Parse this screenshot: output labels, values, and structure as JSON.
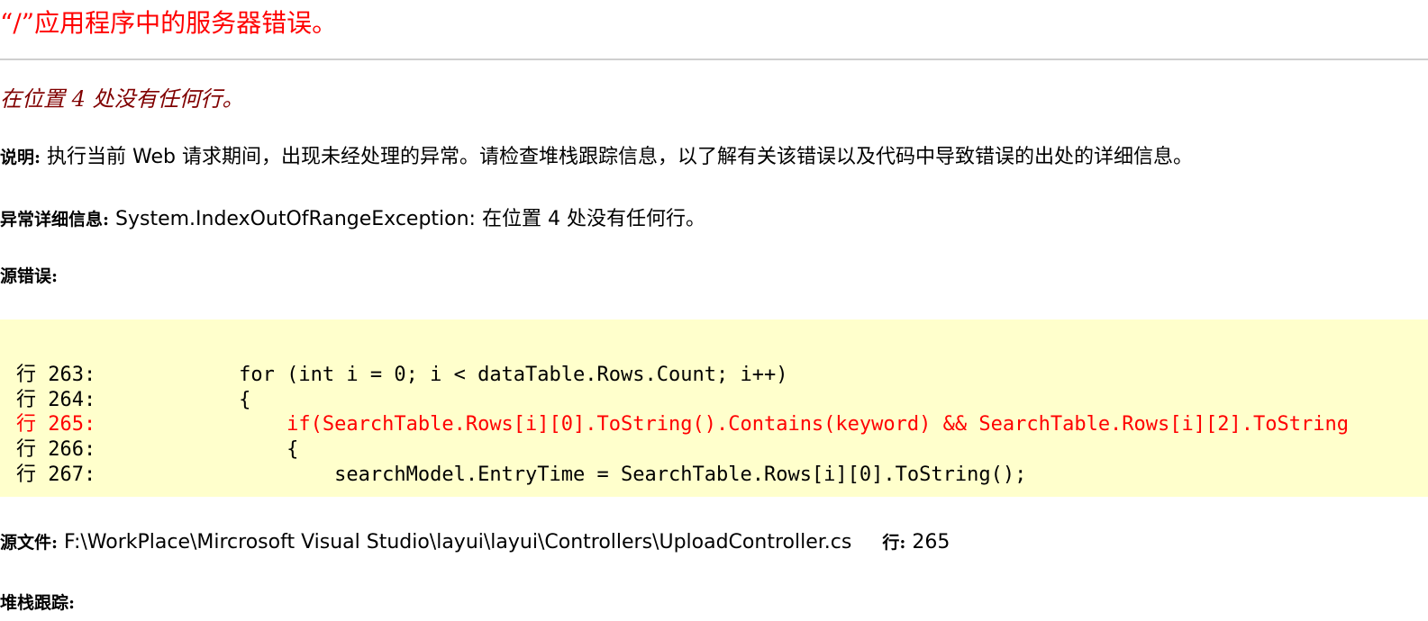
{
  "page": {
    "title": "“/”应用程序中的服务器错误。",
    "error_message": "在位置 4 处没有任何行。"
  },
  "description": {
    "label": "说明:",
    "text": " 执行当前 Web 请求期间，出现未经处理的异常。请检查堆栈跟踪信息，以了解有关该错误以及代码中导致错误的出处的详细信息。"
  },
  "exception_details": {
    "label": "异常详细信息:",
    "text": " System.IndexOutOfRangeException: 在位置 4 处没有任何行。"
  },
  "source_error": {
    "label": "源错误:",
    "lines": [
      {
        "text": "行 263:            for (int i = 0; i < dataTable.Rows.Count; i++)",
        "highlight": false
      },
      {
        "text": "行 264:            {",
        "highlight": false
      },
      {
        "text": "行 265:                if(SearchTable.Rows[i][0].ToString().Contains(keyword) && SearchTable.Rows[i][2].ToString",
        "highlight": true
      },
      {
        "text": "行 266:                {",
        "highlight": false
      },
      {
        "text": "行 267:                    searchModel.EntryTime = SearchTable.Rows[i][0].ToString();",
        "highlight": false
      }
    ],
    "highlight_color": "#ff0000",
    "background_color": "#ffffcc"
  },
  "source_file": {
    "label": "源文件:",
    "path": " F:\\WorkPlace\\Mircrosoft Visual Studio\\layui\\layui\\Controllers\\UploadController.cs",
    "line_label": "行:",
    "line_number": " 265"
  },
  "stack_trace": {
    "label": "堆栈跟踪:"
  },
  "colors": {
    "title": "#ff0000",
    "error_message": "#800000"
  }
}
